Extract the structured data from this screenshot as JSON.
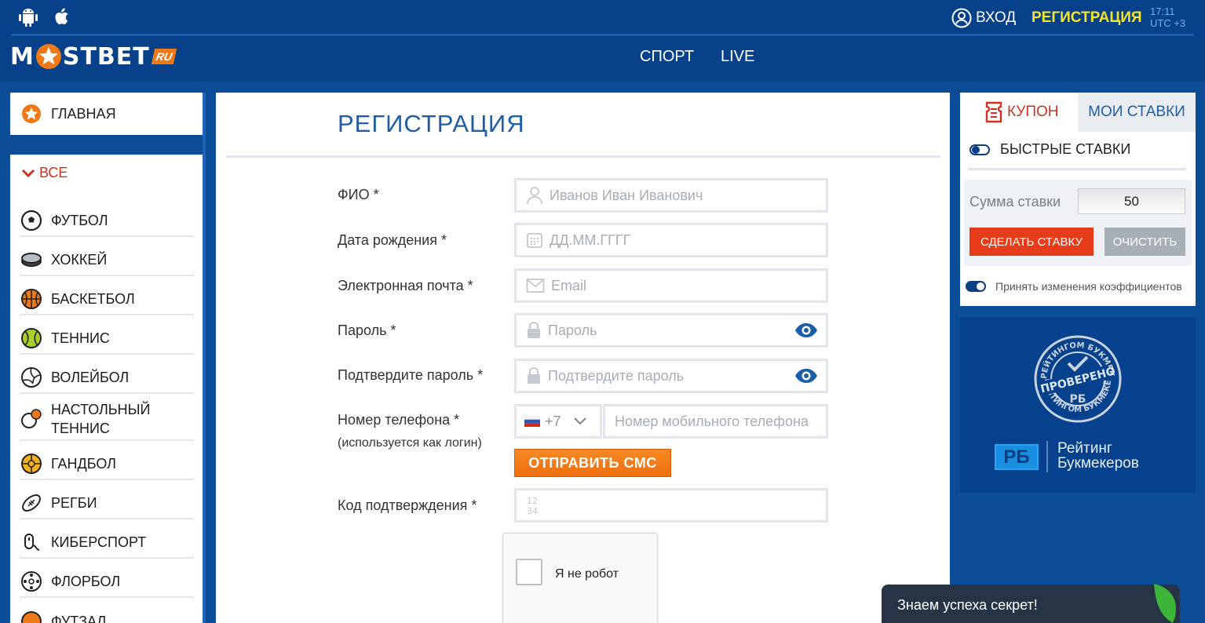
{
  "header": {
    "os_icons": [
      "android-icon",
      "apple-icon"
    ],
    "login_label": "ВХОД",
    "register_label": "РЕГИСТРАЦИЯ",
    "time": "17:11",
    "timezone": "UTC +3"
  },
  "logo": {
    "left": "M",
    "right": "STBET",
    "badge": "RU"
  },
  "nav": {
    "items": [
      "СПОРТ",
      "LIVE"
    ]
  },
  "sidebar": {
    "home_label": "ГЛАВНАЯ",
    "all_label": "ВСЕ",
    "sports": [
      {
        "label": "ФУТБОЛ",
        "icon": "soccer-ball-icon"
      },
      {
        "label": "ХОККЕЙ",
        "icon": "hockey-puck-icon"
      },
      {
        "label": "БАСКЕТБОЛ",
        "icon": "basketball-icon"
      },
      {
        "label": "ТЕННИС",
        "icon": "tennis-ball-icon"
      },
      {
        "label": "ВОЛЕЙБОЛ",
        "icon": "volleyball-icon"
      },
      {
        "label": "НАСТОЛЬНЫЙ ТЕННИС",
        "icon": "table-tennis-icon"
      },
      {
        "label": "ГАНДБОЛ",
        "icon": "handball-icon"
      },
      {
        "label": "РЕГБИ",
        "icon": "rugby-ball-icon"
      },
      {
        "label": "КИБЕРСПОРТ",
        "icon": "esports-icon"
      },
      {
        "label": "ФЛОРБОЛ",
        "icon": "floorball-icon"
      },
      {
        "label": "ФУТЗАЛ",
        "icon": "futsal-icon"
      }
    ]
  },
  "form": {
    "title": "РЕГИСТРАЦИЯ",
    "fields": {
      "name": {
        "label": "ФИО *",
        "placeholder": "Иванов Иван Иванович"
      },
      "birth": {
        "label": "Дата рождения *",
        "placeholder": "ДД.ММ.ГГГГ"
      },
      "email": {
        "label": "Электронная почта *",
        "placeholder": "Email"
      },
      "password": {
        "label": "Пароль *",
        "placeholder": "Пароль"
      },
      "confirm": {
        "label": "Подтвердите пароль *",
        "placeholder": "Подтвердите пароль"
      },
      "phone": {
        "label": "Номер телефона *",
        "sublabel": "(используется как логин)",
        "code": "+7",
        "placeholder": "Номер мобильного телефона"
      },
      "code": {
        "label": "Код подтверждения *"
      }
    },
    "sms_button": "ОТПРАВИТЬ СМС",
    "captcha_label": "Я не робот"
  },
  "betslip": {
    "tab_coupon": "КУПОН",
    "tab_bets": "МОИ СТАВКИ",
    "fast_bets_label": "БЫСТРЫЕ СТАВКИ",
    "stake_label": "Сумма ставки",
    "stake_value": "50",
    "make_bet": "СДЕЛАТЬ СТАВКУ",
    "clear": "ОЧИСТИТЬ",
    "accept_label": "Принять изменения коэффициентов",
    "fast_bets_on": false,
    "accept_on": true
  },
  "rating": {
    "badge": "РБ",
    "line1": "Рейтинг",
    "line2": "Букмекеров",
    "stamp_text": "ПРОВЕРЕНО",
    "stamp_ring_top": "РЕЙТИНГОМ БУКМЕКЕРОВ",
    "stamp_ring_bottom": "РЕЙТИНГОМ БУКМЕКЕРОВ"
  },
  "chat": {
    "text": "Знаем успеха секрет!"
  },
  "colors": {
    "header_bg": "#07418a",
    "page_bg": "#0a4c96",
    "accent_orange": "#ef7916",
    "accent_red": "#d0321f",
    "register_yellow": "#f5e529",
    "title_blue": "#1f5ea5"
  }
}
